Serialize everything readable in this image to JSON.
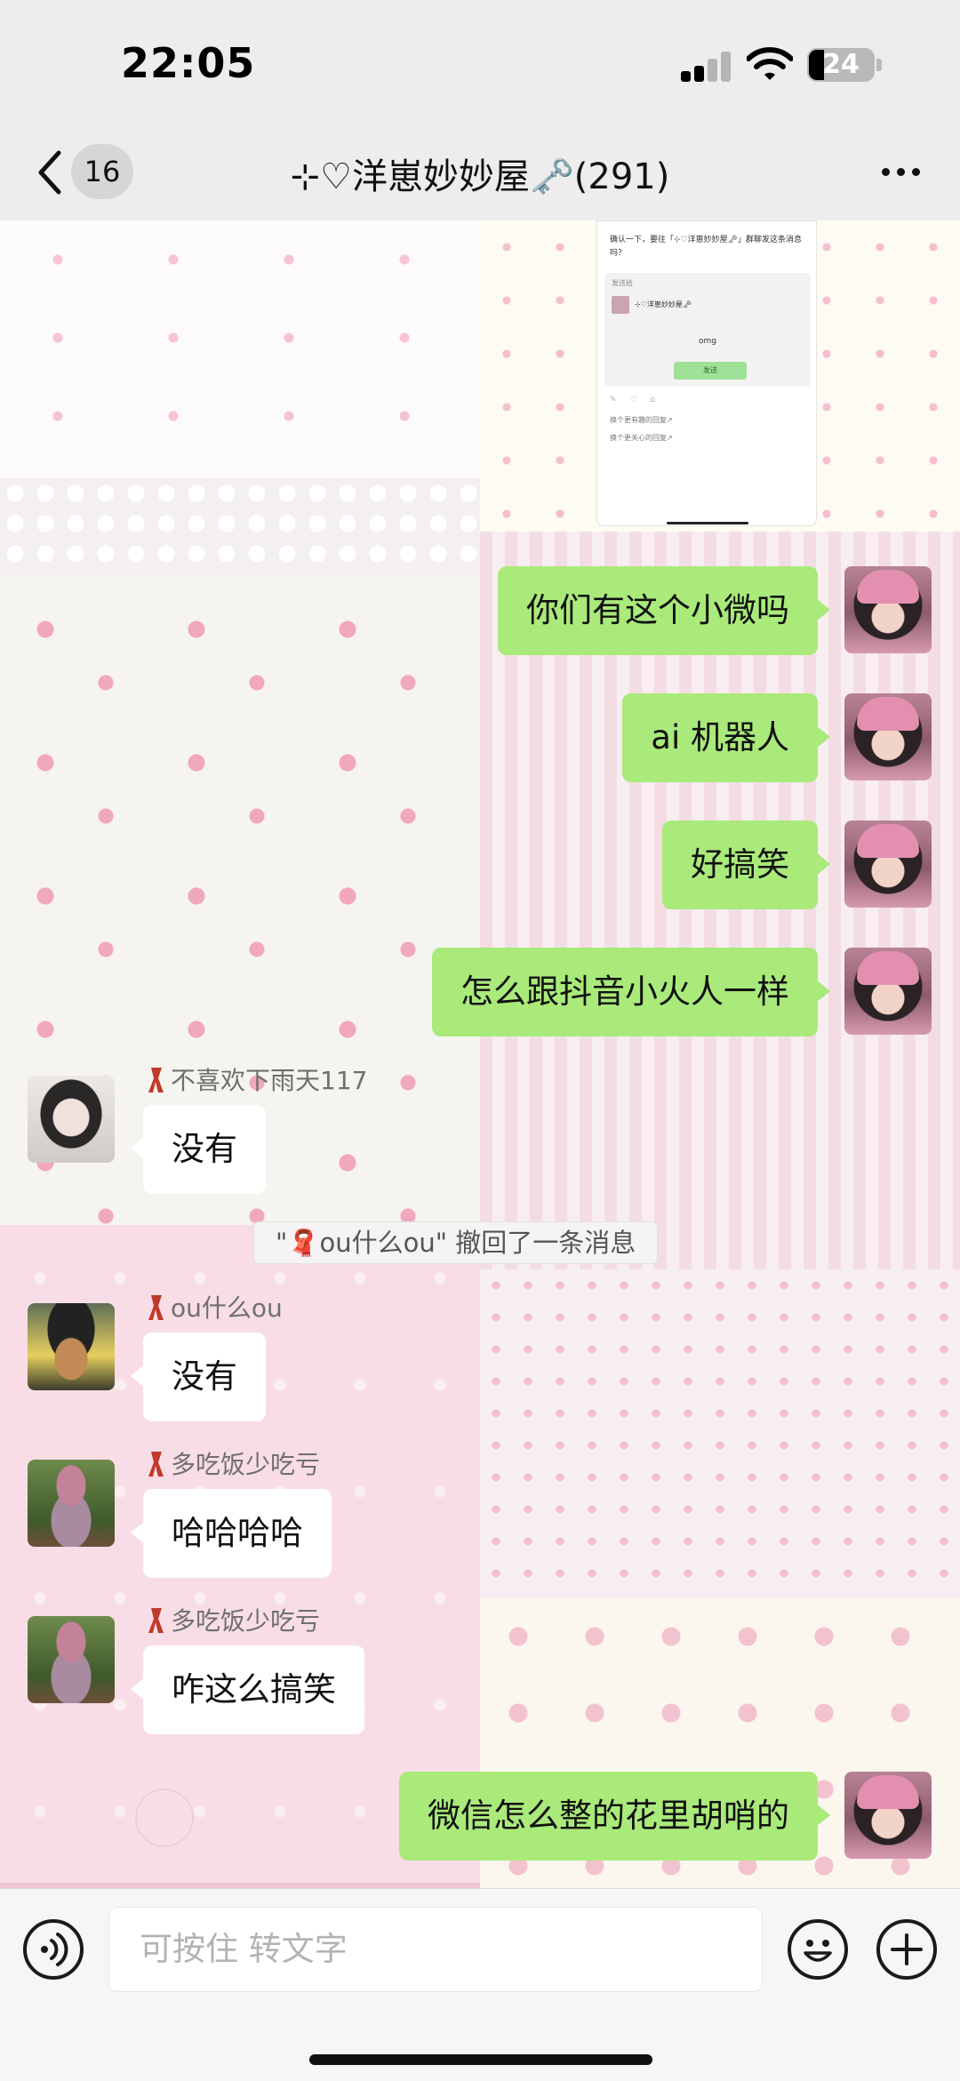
{
  "status_bar": {
    "time": "22:05",
    "battery": "24",
    "battery_level": 0.24
  },
  "header": {
    "back_count": "16",
    "title": "⊹♡洋崽妙妙屋🗝️(291)"
  },
  "shared_card": {
    "text": "确认一下，要往「⊹♡洋崽妙妙屋🗝」群聊发这条消息吗？",
    "to_label": "发送给",
    "group_name": "⊹♡洋崽妙妙屋🗝",
    "message": "omg",
    "send_label": "发送",
    "suggestion_1": "换个更有趣的回复↗",
    "suggestion_2": "换个更关心的回复↗"
  },
  "messages_out_top": [
    {
      "text": "你们有这个小微吗"
    },
    {
      "text": "ai 机器人"
    },
    {
      "text": "好搞笑"
    },
    {
      "text": "怎么跟抖音小火人一样"
    }
  ],
  "messages_in": [
    {
      "sender": "不喜欢下雨天117",
      "text": "没有"
    },
    {
      "sender": "ou什么ou",
      "text": "没有"
    },
    {
      "sender": "多吃饭少吃亏",
      "text": "哈哈哈哈"
    },
    {
      "sender": "多吃饭少吃亏",
      "text": "咋这么搞笑"
    }
  ],
  "system_notice": "\"🧣ou什么ou\" 撤回了一条消息",
  "messages_out_bottom": [
    {
      "text": "微信怎么整的花里胡哨的"
    }
  ],
  "input": {
    "placeholder": "可按住 转文字"
  },
  "colors": {
    "outgoing_bubble": "#a9ea7a",
    "incoming_bubble": "#ffffff",
    "background": "#ededed"
  }
}
